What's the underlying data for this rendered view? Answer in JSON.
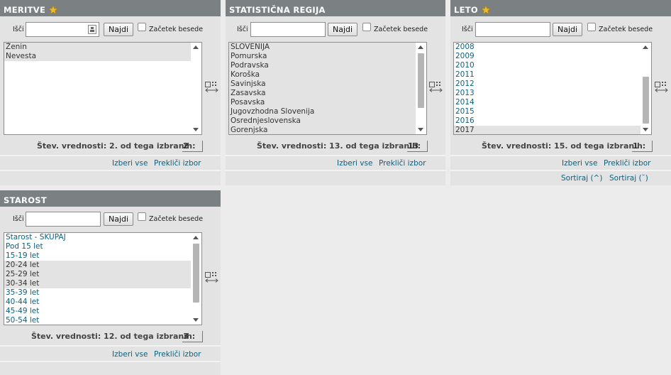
{
  "common": {
    "search_label": "Išči",
    "search_button": "Najdi",
    "begin_word_label": "Začetek besede",
    "select_all": "Izberi vse",
    "clear_selection": "Prekliči izbor",
    "sort_asc": "Sortiraj (^)",
    "sort_desc": "Sortiraj (˘)"
  },
  "meritve": {
    "title": "MERITVE",
    "items": [
      "Ženin",
      "Nevesta"
    ],
    "count_text": "Štev. vrednosti: 2. od tega izbranih:",
    "selected_count": "2"
  },
  "regija": {
    "title": "STATISTIČNA REGIJA",
    "items": [
      "SLOVENIJA",
      "Pomurska",
      "Podravska",
      "Koroška",
      "Savinjska",
      "Zasavska",
      "Posavska",
      "Jugovzhodna Slovenija",
      "Osrednjeslovenska",
      "Gorenjska"
    ],
    "count_text": "Štev. vrednosti: 13. od tega izbranih:",
    "selected_count": "13"
  },
  "leto": {
    "title": "LETO",
    "items": [
      "2008",
      "2009",
      "2010",
      "2011",
      "2012",
      "2013",
      "2014",
      "2015",
      "2016",
      "2017"
    ],
    "count_text": "Štev. vrednosti: 15. od tega izbranih:",
    "selected_count": "1"
  },
  "starost": {
    "title": "STAROST",
    "items": [
      "Starost - SKUPAJ",
      "Pod 15 let",
      "15-19 let",
      "20-24 let",
      "25-29 let",
      "30-34 let",
      "35-39 let",
      "40-44 let",
      "45-49 let",
      "50-54 let"
    ],
    "count_text": "Štev. vrednosti: 12. od tega izbranih:",
    "selected_count": "3"
  },
  "colors": {
    "header_bg": "#7b8083",
    "panel_bg": "#e3e3e3",
    "link": "#0d5f7c",
    "star": "#e8b830"
  },
  "icons": {
    "star": "star-icon",
    "value_picker": "value-picker-icon",
    "expand": "expand-list-icon"
  }
}
